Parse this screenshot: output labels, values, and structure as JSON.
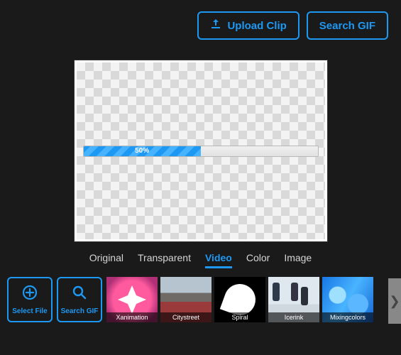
{
  "topbar": {
    "upload_label": "Upload Clip",
    "search_label": "Search GIF"
  },
  "canvas": {
    "progress_percent": 50,
    "progress_label": "50%"
  },
  "tabs": {
    "items": [
      {
        "label": "Original",
        "active": false
      },
      {
        "label": "Transparent",
        "active": false
      },
      {
        "label": "Video",
        "active": true
      },
      {
        "label": "Color",
        "active": false
      },
      {
        "label": "Image",
        "active": false
      }
    ]
  },
  "gallery": {
    "select_file_label": "Select File",
    "search_gif_label": "Search GIF",
    "thumbs": [
      {
        "label": "Xanimation"
      },
      {
        "label": "Citystreet"
      },
      {
        "label": "Spiral"
      },
      {
        "label": "Icerink"
      },
      {
        "label": "Mixingcolors"
      }
    ]
  }
}
